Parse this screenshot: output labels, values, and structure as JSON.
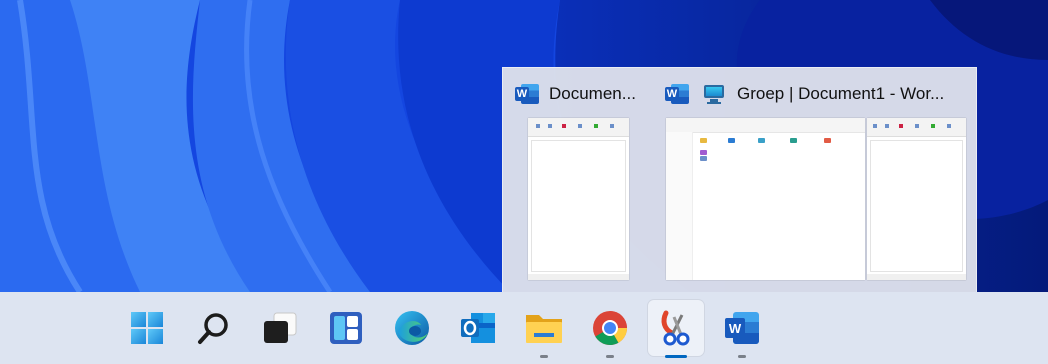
{
  "colors": {
    "accent": "#0067c0",
    "taskbar": "#dde4f1",
    "wallpaper": "#0a3fe0"
  },
  "preview": {
    "windows": [
      {
        "app_icon": "word-icon",
        "title": "Documen..."
      },
      {
        "app_icon": "word-icon",
        "secondary_icon": "monitor-icon",
        "title": "Groep | Document1 - Wor..."
      }
    ]
  },
  "taskbar": {
    "items": [
      {
        "name": "start",
        "icon": "windows-logo-icon",
        "running": false
      },
      {
        "name": "search",
        "icon": "search-icon",
        "running": false
      },
      {
        "name": "task-view",
        "icon": "task-view-icon",
        "running": false
      },
      {
        "name": "widgets",
        "icon": "widgets-icon",
        "running": false
      },
      {
        "name": "edge",
        "icon": "edge-icon",
        "running": false
      },
      {
        "name": "outlook",
        "icon": "outlook-icon",
        "running": false
      },
      {
        "name": "file-explorer",
        "icon": "folder-icon",
        "running": true
      },
      {
        "name": "chrome",
        "icon": "chrome-icon",
        "running": true
      },
      {
        "name": "snipping-tool",
        "icon": "scissors-icon",
        "running": true,
        "focused": true
      },
      {
        "name": "word",
        "icon": "word-icon",
        "running": true
      }
    ]
  }
}
